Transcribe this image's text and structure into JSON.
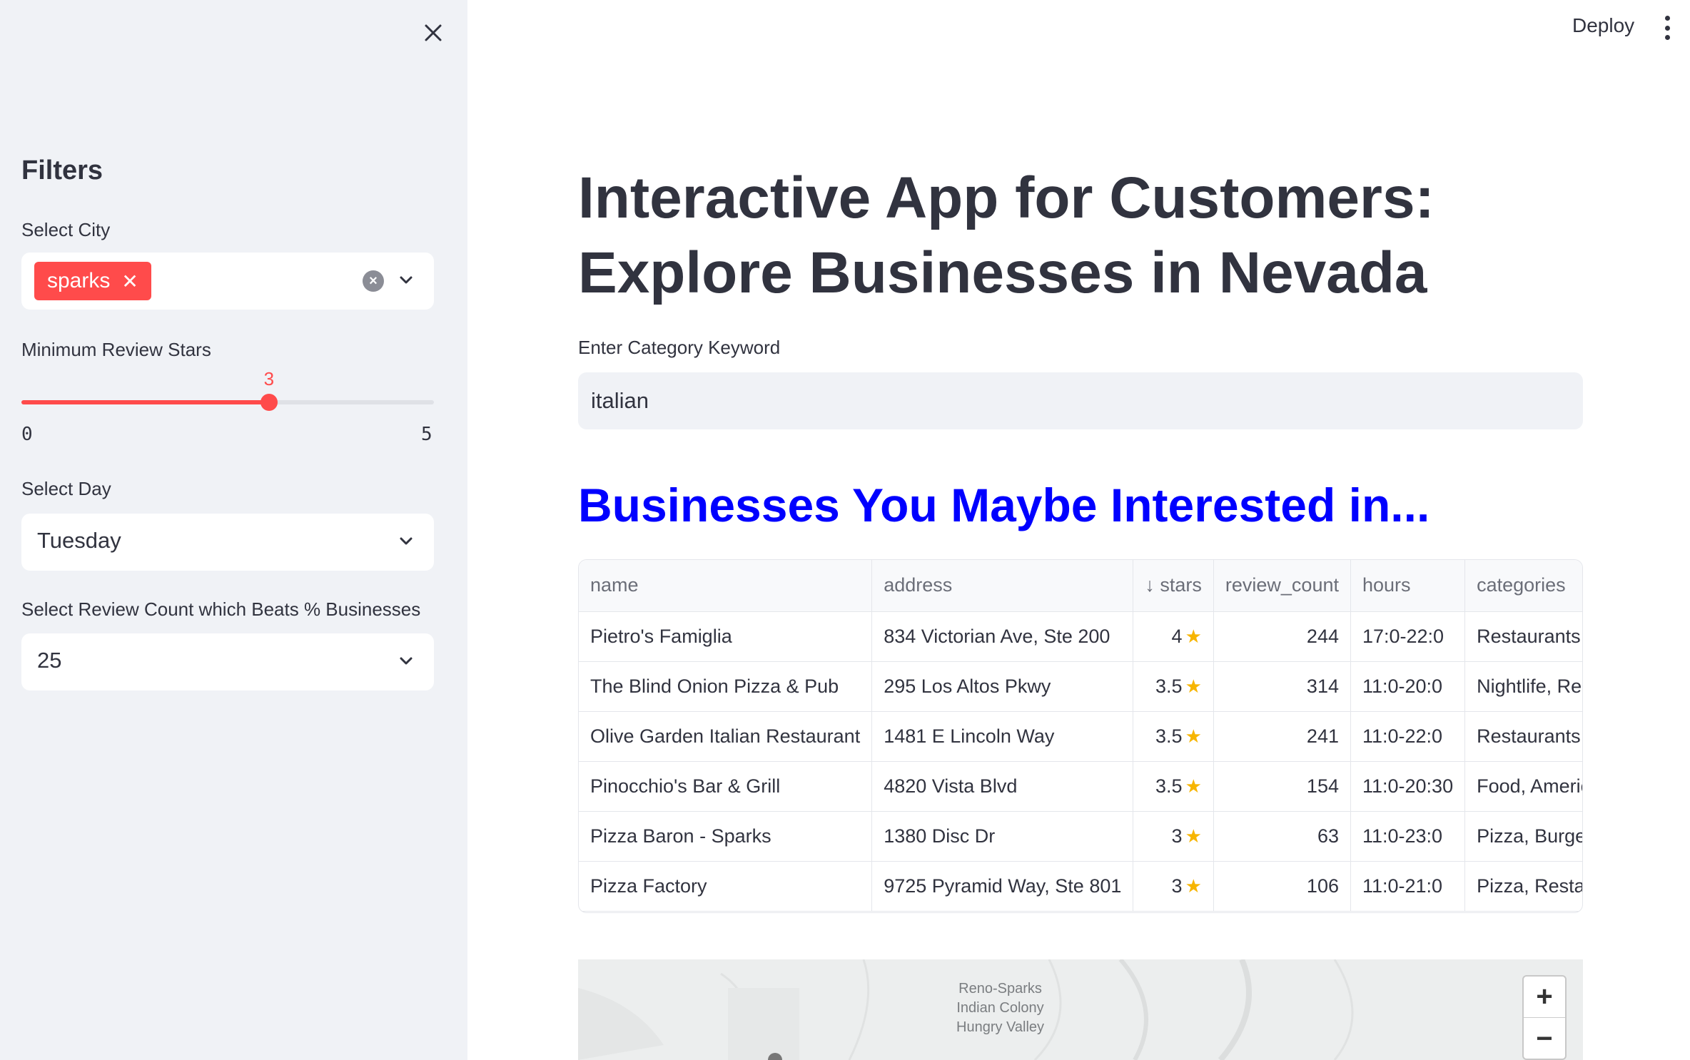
{
  "header": {
    "deploy_label": "Deploy"
  },
  "sidebar": {
    "title": "Filters",
    "city": {
      "label": "Select City",
      "chip": "sparks",
      "chip_close": "✕"
    },
    "stars": {
      "label": "Minimum Review Stars",
      "value": 3,
      "value_text": "3",
      "min": "0",
      "max": "5",
      "fraction": 0.6
    },
    "day": {
      "label": "Select Day",
      "value": "Tuesday"
    },
    "review_count": {
      "label": "Select Review Count which Beats % Businesses",
      "value": "25"
    }
  },
  "main": {
    "title": "Interactive App for Customers: Explore Businesses in Nevada",
    "keyword": {
      "label": "Enter Category Keyword",
      "value": "italian"
    },
    "section_title": "Businesses You Maybe Interested in...",
    "table": {
      "headers": [
        "name",
        "address",
        "↓ stars",
        "review_count",
        "hours",
        "categories"
      ],
      "rows": [
        {
          "name": "Pietro's Famiglia",
          "address": "834 Victorian Ave, Ste 200",
          "stars": "4",
          "review_count": "244",
          "hours": "17:0-22:0",
          "categories": "Restaurants, Itali"
        },
        {
          "name": "The Blind Onion Pizza & Pub",
          "address": "295 Los Altos Pkwy",
          "stars": "3.5",
          "review_count": "314",
          "hours": "11:0-20:0",
          "categories": "Nightlife, Restau"
        },
        {
          "name": "Olive Garden Italian Restaurant",
          "address": "1481 E Lincoln Way",
          "stars": "3.5",
          "review_count": "241",
          "hours": "11:0-22:0",
          "categories": "Restaurants, Sala"
        },
        {
          "name": "Pinocchio's Bar & Grill",
          "address": "4820 Vista Blvd",
          "stars": "3.5",
          "review_count": "154",
          "hours": "11:0-20:30",
          "categories": "Food, American ("
        },
        {
          "name": "Pizza Baron - Sparks",
          "address": "1380 Disc Dr",
          "stars": "3",
          "review_count": "63",
          "hours": "11:0-23:0",
          "categories": "Pizza, Burgers, N"
        },
        {
          "name": "Pizza Factory",
          "address": "9725 Pyramid Way, Ste 801",
          "stars": "3",
          "review_count": "106",
          "hours": "11:0-21:0",
          "categories": "Pizza, Restaurant"
        }
      ]
    },
    "map": {
      "label_1": "Reno-Sparks",
      "label_2": "Indian Colony",
      "label_3": "Hungry Valley",
      "zoom_in": "+",
      "zoom_out": "−"
    }
  },
  "colors": {
    "accent": "#ff4b4b",
    "section_title": "#0000ff",
    "sidebar_bg": "#f0f2f6"
  }
}
